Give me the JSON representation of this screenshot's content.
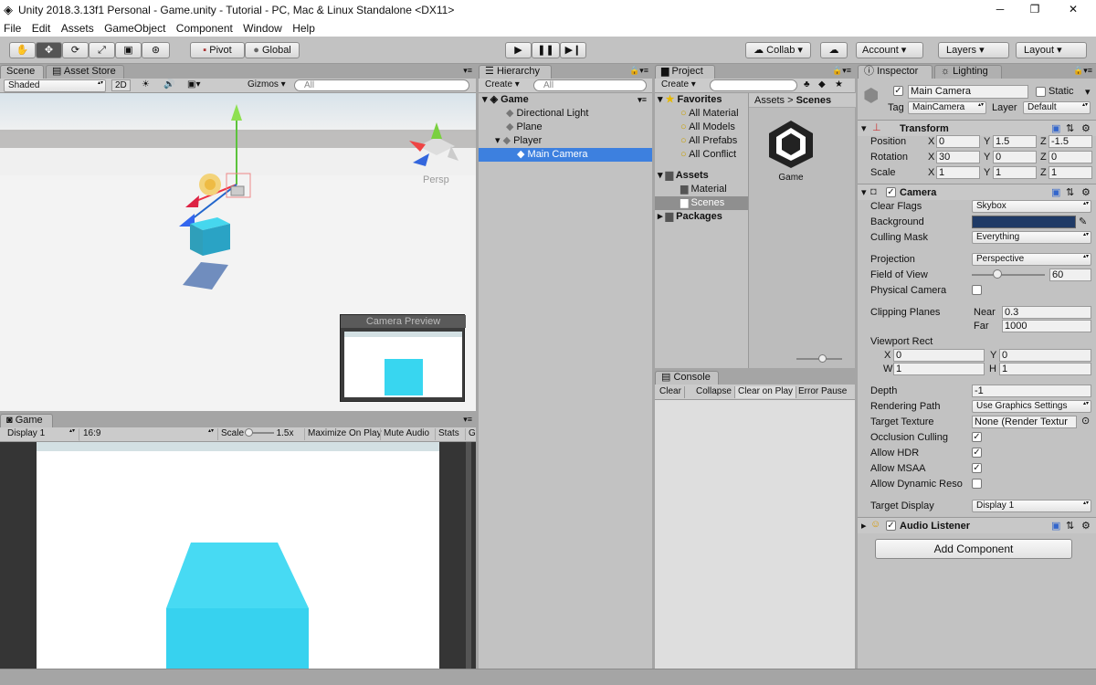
{
  "window": {
    "title": "Unity 2018.3.13f1 Personal - Game.unity - Tutorial - PC, Mac & Linux Standalone <DX11>",
    "minimize": "─",
    "maximize": "❐",
    "close": "✕"
  },
  "menu": [
    "File",
    "Edit",
    "Assets",
    "GameObject",
    "Component",
    "Window",
    "Help"
  ],
  "toolbar": {
    "pivot": "Pivot",
    "global": "Global",
    "collab": "Collab",
    "account": "Account",
    "layers": "Layers",
    "layout": "Layout"
  },
  "scene": {
    "tab": "Scene",
    "tab2": "Asset Store",
    "shading": "Shaded",
    "mode2d": "2D",
    "gizmos": "Gizmos",
    "search_placeholder": "All",
    "persp": "Persp",
    "camera_preview": "Camera Preview"
  },
  "game": {
    "tab": "Game",
    "display": "Display 1",
    "aspect": "16:9",
    "scale_label": "Scale",
    "scale_value": "1.5x",
    "maximize": "Maximize On Play",
    "mute": "Mute Audio",
    "stats": "Stats",
    "gizmos_short": "G"
  },
  "hierarchy": {
    "tab": "Hierarchy",
    "create": "Create",
    "search_placeholder": "All",
    "scene_name": "Game",
    "items": [
      "Directional Light",
      "Plane",
      "Player",
      "Main Camera"
    ]
  },
  "project": {
    "tab": "Project",
    "create": "Create",
    "favorites": "Favorites",
    "favorite_items": [
      "All Material",
      "All Models",
      "All Prefabs",
      "All Conflict"
    ],
    "assets": "Assets",
    "asset_folders": [
      "Material",
      "Scenes"
    ],
    "packages": "Packages",
    "breadcrumb_root": "Assets",
    "breadcrumb_sep": ">",
    "breadcrumb_current": "Scenes",
    "file_name": "Game"
  },
  "console": {
    "tab": "Console",
    "buttons": [
      "Clear",
      "Collapse",
      "Clear on Play",
      "Error Pause"
    ]
  },
  "inspector": {
    "tab": "Inspector",
    "tab2": "Lighting",
    "object_name": "Main Camera",
    "static_label": "Static",
    "tag_label": "Tag",
    "tag_value": "MainCamera",
    "layer_label": "Layer",
    "layer_value": "Default",
    "transform": {
      "title": "Transform",
      "position_label": "Position",
      "rotation_label": "Rotation",
      "scale_label": "Scale",
      "axis_x": "X",
      "axis_y": "Y",
      "axis_z": "Z",
      "position": [
        "0",
        "1.5",
        "-1.5"
      ],
      "rotation": [
        "30",
        "0",
        "0"
      ],
      "scale": [
        "1",
        "1",
        "1"
      ]
    },
    "camera": {
      "title": "Camera",
      "clear_flags_label": "Clear Flags",
      "clear_flags": "Skybox",
      "background_label": "Background",
      "background_color": "#1f3a66",
      "culling_mask_label": "Culling Mask",
      "culling_mask": "Everything",
      "projection_label": "Projection",
      "projection": "Perspective",
      "fov_label": "Field of View",
      "fov": "60",
      "physical_label": "Physical Camera",
      "clipping_label": "Clipping Planes",
      "near_label": "Near",
      "near": "0.3",
      "far_label": "Far",
      "far": "1000",
      "viewport_label": "Viewport Rect",
      "vx_label": "X",
      "vx": "0",
      "vy_label": "Y",
      "vy": "0",
      "vw_label": "W",
      "vw": "1",
      "vh_label": "H",
      "vh": "1",
      "depth_label": "Depth",
      "depth": "-1",
      "render_path_label": "Rendering Path",
      "render_path": "Use Graphics Settings",
      "target_texture_label": "Target Texture",
      "target_texture": "None (Render Textur",
      "occlusion_label": "Occlusion Culling",
      "hdr_label": "Allow HDR",
      "msaa_label": "Allow MSAA",
      "dyn_res_label": "Allow Dynamic Reso",
      "target_display_label": "Target Display",
      "target_display": "Display 1"
    },
    "audio_listener": "Audio Listener",
    "add_component": "Add Component"
  }
}
